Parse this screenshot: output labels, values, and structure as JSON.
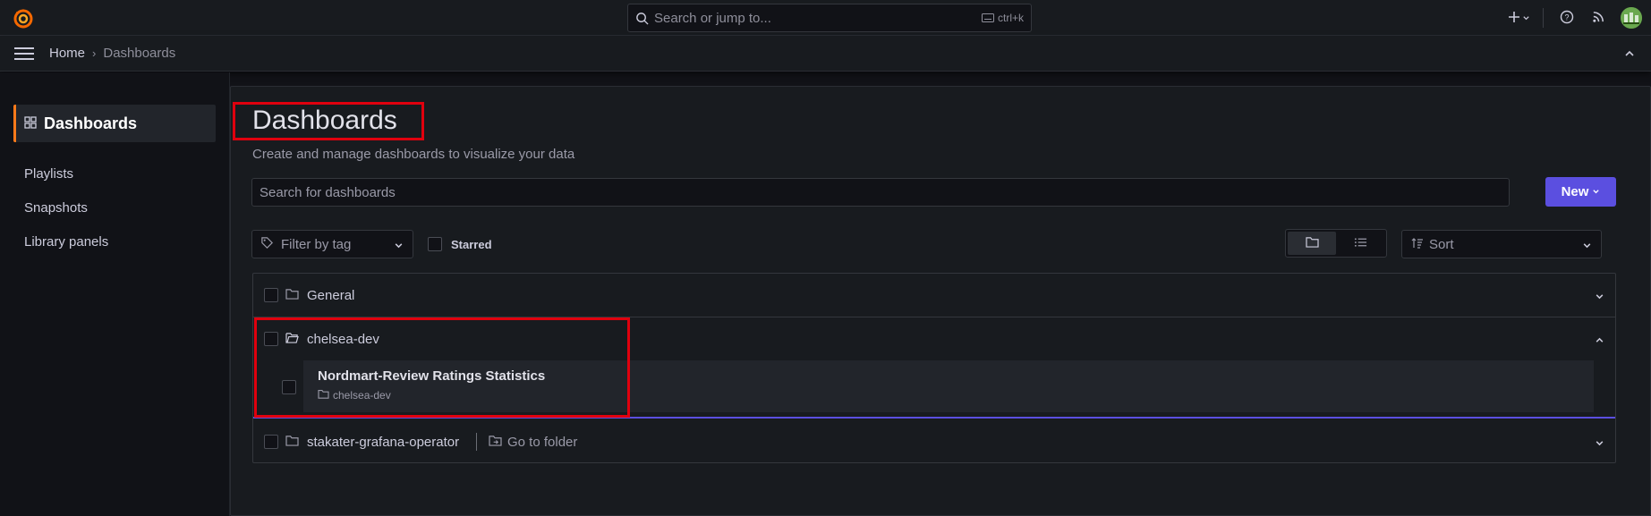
{
  "topbar": {
    "search_placeholder": "Search or jump to...",
    "search_shortcut": "ctrl+k",
    "icons": [
      "plus-icon",
      "help-icon",
      "rss-icon"
    ]
  },
  "breadcrumb": {
    "home": "Home",
    "separator": "›",
    "current": "Dashboards"
  },
  "sidebar": {
    "active_label": "Dashboards",
    "items": [
      {
        "label": "Playlists"
      },
      {
        "label": "Snapshots"
      },
      {
        "label": "Library panels"
      }
    ]
  },
  "main": {
    "title": "Dashboards",
    "subtitle": "Create and manage dashboards to visualize your data",
    "search_placeholder": "Search for dashboards",
    "new_button": "New",
    "filter_by_tag": "Filter by tag",
    "starred_label": "Starred",
    "sort_label": "Sort"
  },
  "folders": [
    {
      "name": "General",
      "expanded": false
    },
    {
      "name": "chelsea-dev",
      "expanded": true,
      "dashboards": [
        {
          "title": "Nordmart-Review Ratings Statistics",
          "folder": "chelsea-dev"
        }
      ]
    },
    {
      "name": "stakater-grafana-operator",
      "expanded": false,
      "action": "Go to folder"
    }
  ],
  "colors": {
    "accent": "#5b4fe0",
    "active_border": "#ff7a1a",
    "highlight": "#e0000e"
  }
}
